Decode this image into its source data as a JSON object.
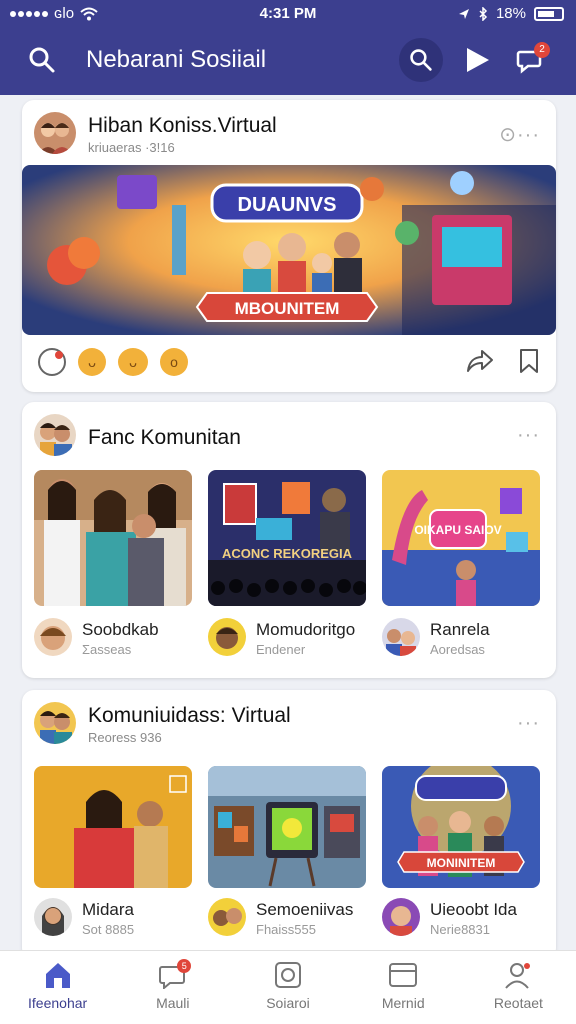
{
  "status": {
    "carrier": "ɢlo",
    "time": "4:31 PM",
    "battery": "18%"
  },
  "header": {
    "title": "Nebarani Sosiiail",
    "notif_count": "2"
  },
  "post": {
    "title": "Hiban Koniss.Virtual",
    "subtitle": "kriuaeras ·3!16",
    "banner_top": "DUAUNVS",
    "banner_bottom": "MBOUNITEM"
  },
  "community1": {
    "title": "Fanc Komunitan",
    "tiles": [
      {
        "caption": ""
      },
      {
        "caption": "ACONC REKOREGIA"
      },
      {
        "caption": "OIKAPU SAIOV"
      }
    ],
    "people": [
      {
        "name": "Soobdkab",
        "sub": "Σasseas"
      },
      {
        "name": "Momudoritgo",
        "sub": "Endener"
      },
      {
        "name": "Ranrela",
        "sub": "Aoredsas"
      }
    ]
  },
  "community2": {
    "title": "Komuniuidass: Virtual",
    "subtitle": "Reoress 936",
    "tiles": [
      {
        "caption": ""
      },
      {
        "caption": ""
      },
      {
        "caption": "MONINITEM"
      }
    ],
    "people": [
      {
        "name": "Midara",
        "sub": "Sot 8885"
      },
      {
        "name": "Semoeniivas",
        "sub": "Fhaiss555"
      },
      {
        "name": "Uieoobt Ida",
        "sub": "Nerie8831"
      }
    ]
  },
  "nav": [
    {
      "label": "Ifeenohar"
    },
    {
      "label": "Mauli",
      "badge": "5"
    },
    {
      "label": "Soiaroi"
    },
    {
      "label": "Mernid"
    },
    {
      "label": "Reotaet"
    }
  ],
  "colors": {
    "brand": "#3c3f8f",
    "accent": "#e0463a"
  }
}
